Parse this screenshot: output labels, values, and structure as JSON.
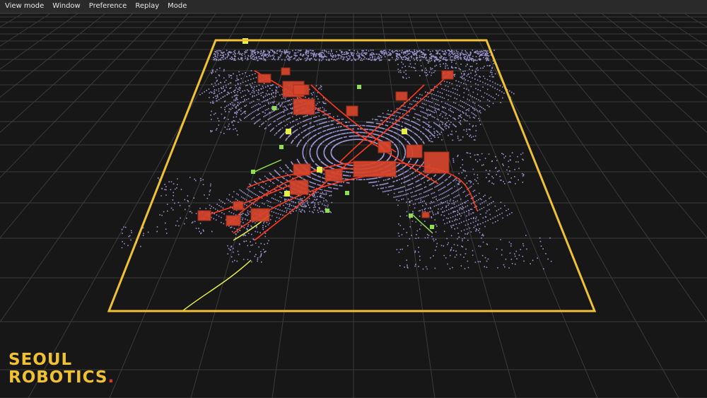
{
  "menu": {
    "items": [
      "View mode",
      "Window",
      "Preference",
      "Replay",
      "Mode"
    ]
  },
  "logo": {
    "line1": "SEOUL",
    "line2": "ROBOTICS",
    "dot": "."
  },
  "colors": {
    "background": "#171717",
    "grid": "#3b3b3b",
    "boundary": "#f0c232",
    "point_cloud": "#a9a2e6",
    "vehicle": "#d8452c",
    "pedestrian": "#8fe04a",
    "cyclist": "#e6ee4a",
    "track": "#ff3a1e"
  }
}
